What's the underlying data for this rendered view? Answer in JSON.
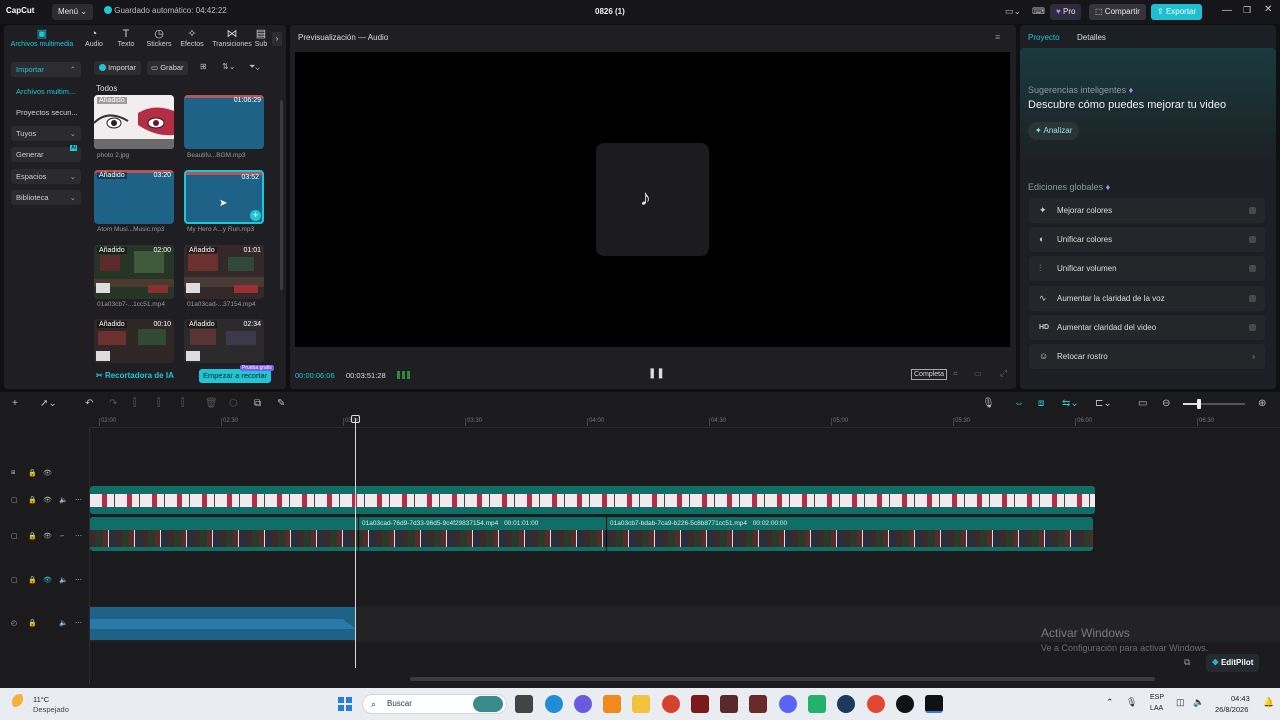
{
  "titlebar": {
    "logo": "CapCut",
    "menu_label": "Menú",
    "autosave": "Guardado automático: 04:42:22",
    "project_title": "0826 (1)",
    "pro_label": "Pro",
    "share_label": "Compartir",
    "export_label": "Exportar"
  },
  "media_tabs": [
    {
      "label": "Archivos multimedia",
      "icon": "media-icon"
    },
    {
      "label": "Audio",
      "icon": "audio-icon"
    },
    {
      "label": "Texto",
      "icon": "text-icon"
    },
    {
      "label": "Stickers",
      "icon": "sticker-icon"
    },
    {
      "label": "Efectos",
      "icon": "effects-icon"
    },
    {
      "label": "Transiciones",
      "icon": "transitions-icon"
    },
    {
      "label": "Sub",
      "icon": "subtitles-icon"
    }
  ],
  "sidebar": {
    "items": [
      {
        "label": "Importar"
      },
      {
        "label": "Archivos multim..."
      },
      {
        "label": "Proyectos secun..."
      },
      {
        "label": "Tuyos"
      },
      {
        "label": "Generar"
      },
      {
        "label": "Espacios"
      },
      {
        "label": "Biblioteca"
      }
    ]
  },
  "media_toolbar": {
    "import_label": "Importar",
    "record_label": "Grabar",
    "section_label": "Todos"
  },
  "media_items": [
    {
      "name": "photo 2.jpg",
      "badge": "Añadido",
      "duration": ""
    },
    {
      "name": "Beautifu...BGM.mp3",
      "badge": "",
      "duration": "01:06:29"
    },
    {
      "name": "Atom Musi...Music.mp3",
      "badge": "Añadido",
      "duration": "03:20"
    },
    {
      "name": "My Hero A...y Run.mp3",
      "badge": "",
      "duration": "03:52"
    },
    {
      "name": "01a03cb7-...1cc51.mp4",
      "badge": "Añadido",
      "duration": "02:00"
    },
    {
      "name": "01a03cad-...37154.mp4",
      "badge": "Añadido",
      "duration": "01:01"
    },
    {
      "name": "",
      "badge": "Añadido",
      "duration": "00:10"
    },
    {
      "name": "",
      "badge": "Añadido",
      "duration": "02:34"
    }
  ],
  "media_footer": {
    "ai_cutter": "Recortadora de IA",
    "start_cut": "Empezar a recortar",
    "start_badge": "Prueba gratis"
  },
  "preview": {
    "title": "Previsualización — Audio",
    "current_time": "00:00:06:06",
    "total_time": "00:03:51:28",
    "ratio_label": "Completa"
  },
  "right_panel": {
    "tabs": [
      "Proyecto",
      "Detalles"
    ],
    "smart_title": "Sugerencias inteligentes",
    "smart_heading": "Descubre cómo puedes mejorar tu video",
    "analyze_label": "Analizar",
    "global_title": "Ediciones globales",
    "rows": [
      {
        "label": "Mejorar colores",
        "icon": "magic-wand-icon",
        "glyph": "✦"
      },
      {
        "label": "Unificar colores",
        "icon": "color-icon",
        "glyph": "◐"
      },
      {
        "label": "Unificar volumen",
        "icon": "volume-bars-icon",
        "glyph": "⫶"
      },
      {
        "label": "Aumentar la claridad de la voz",
        "icon": "voice-icon",
        "glyph": "∿"
      },
      {
        "label": "Aumentar claridad del video",
        "icon": "hd-icon",
        "glyph": "HD"
      },
      {
        "label": "Retocar rostro",
        "icon": "face-icon",
        "glyph": "☺"
      }
    ]
  },
  "timeline": {
    "ruler": [
      "02:00",
      "02:30",
      "03:00",
      "03:30",
      "04:00",
      "04:30",
      "05:00",
      "05:30",
      "06:00",
      "06:30"
    ],
    "clip1_label": "01a03cad-76d9-7d33-96d5-9c4f29837154.mp4",
    "clip1_time": "00:01:01:00",
    "clip2_label": "01a03cb7-bdab-7ca9-b226-5c8b8771cc51.mp4",
    "clip2_time": "00:02:00:00"
  },
  "watermark": {
    "line1": "Activar Windows",
    "line2": "Ve a Configuración para activar Windows."
  },
  "editpilot_label": "EditPilot",
  "taskbar": {
    "temp": "11°C",
    "weather": "Despejado",
    "search_placeholder": "Buscar",
    "lang1": "ESP",
    "lang2": "LAA",
    "time": "04:43",
    "date": "26/8/2026"
  },
  "colors": {
    "accent": "#1fc6d6",
    "export": "#1fbfd0",
    "audio_clip": "#1f6287",
    "track_teal": "#0f6e66"
  }
}
